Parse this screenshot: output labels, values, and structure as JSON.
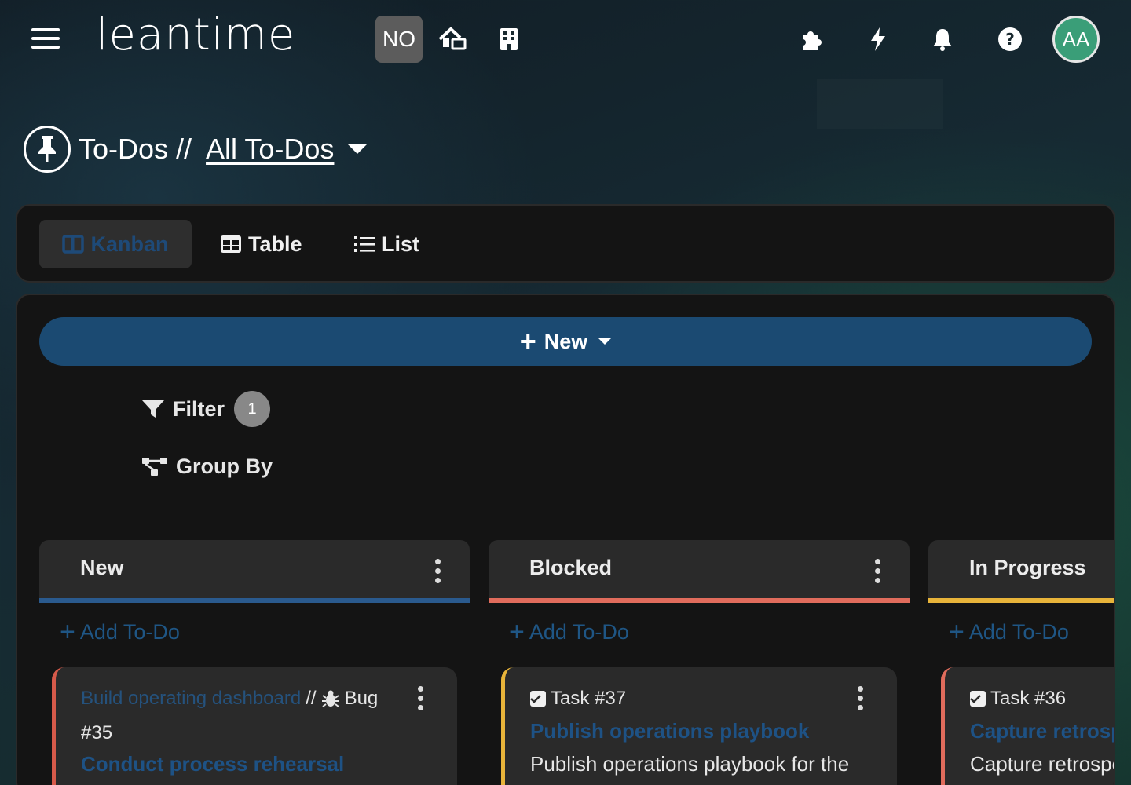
{
  "header": {
    "logo_text": "leantime",
    "project_badge": "NO",
    "avatar_initials": "AA"
  },
  "page": {
    "section": "To-Dos //",
    "view_name": "All To-Dos"
  },
  "views": {
    "kanban": "Kanban",
    "table": "Table",
    "list": "List"
  },
  "toolbar": {
    "new_label": "New",
    "filter_label": "Filter",
    "filter_count": "1",
    "group_by_label": "Group By"
  },
  "columns": [
    {
      "title": "New",
      "color": "#2a5a8e",
      "add_label": "Add To-Do",
      "card": {
        "project": "Build operating dashboard",
        "type": "Bug",
        "id": "#35",
        "title": "Conduct process rehearsal"
      }
    },
    {
      "title": "Blocked",
      "color": "#e06c5c",
      "add_label": "Add To-Do",
      "card": {
        "type": "Task #37",
        "title": "Publish operations playbook",
        "description": "Publish operations playbook for the"
      }
    },
    {
      "title": "In Progress",
      "color": "#e8b43a",
      "add_label": "Add To-Do",
      "card": {
        "type": "Task #36",
        "title": "Capture retrospective",
        "description": "Capture retrospective"
      }
    }
  ]
}
